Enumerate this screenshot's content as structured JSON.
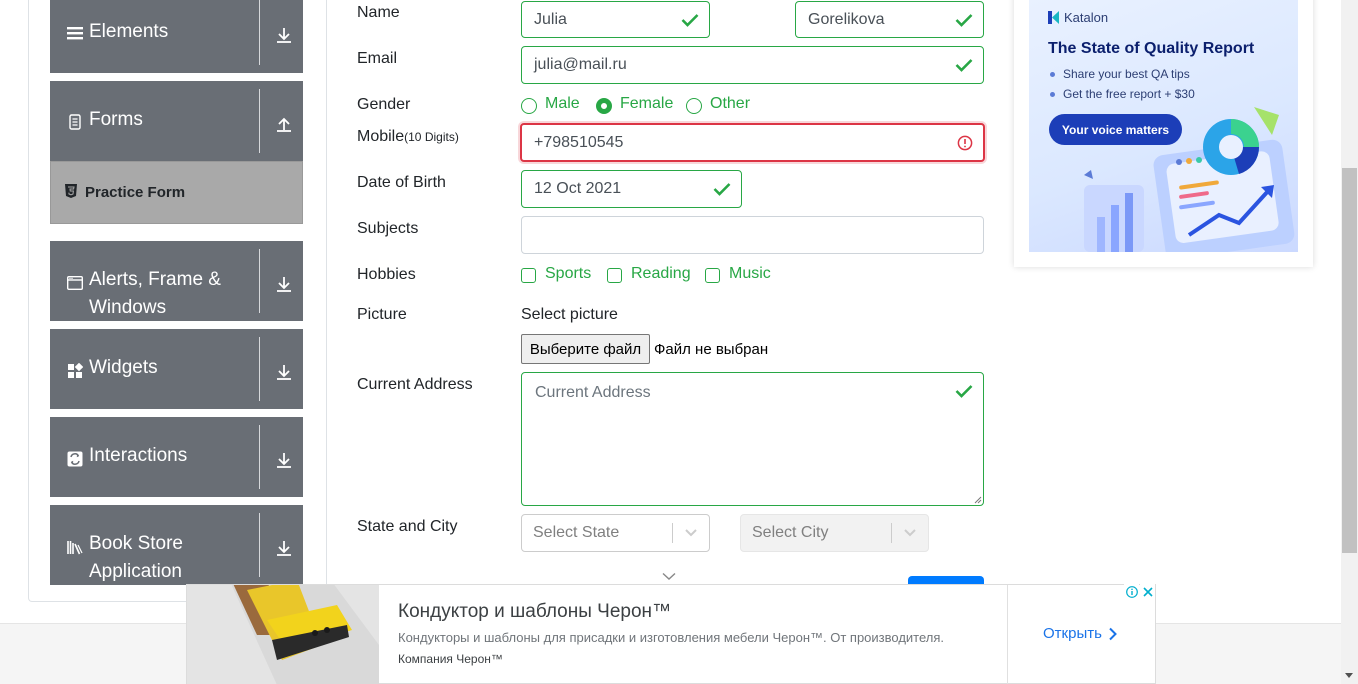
{
  "sidebar": {
    "groups": [
      {
        "label": "Elements",
        "icon": "list-icon",
        "arrow": "arrow-down-icon"
      },
      {
        "label": "Forms",
        "icon": "document-icon",
        "arrow": "arrow-up-icon"
      },
      {
        "label": "Alerts, Frame & Windows",
        "label_line1": "Alerts, Frame &",
        "label_line2": "Windows",
        "icon": "window-icon",
        "arrow": "arrow-down-icon"
      },
      {
        "label": "Widgets",
        "icon": "widgets-icon",
        "arrow": "arrow-down-icon"
      },
      {
        "label": "Interactions",
        "icon": "interactions-icon",
        "arrow": "arrow-down-icon"
      },
      {
        "label": "Book Store Application",
        "label_line1": "Book Store",
        "label_line2": "Application",
        "icon": "books-icon",
        "arrow": "arrow-down-icon"
      }
    ],
    "active_item": {
      "label": "Practice Form",
      "icon": "html5-icon"
    }
  },
  "form": {
    "name": {
      "label": "Name",
      "first_name": "Julia",
      "last_name": "Gorelikova"
    },
    "email": {
      "label": "Email",
      "value": "julia@mail.ru"
    },
    "gender": {
      "label": "Gender",
      "options": [
        "Male",
        "Female",
        "Other"
      ],
      "selected": "Female"
    },
    "mobile": {
      "label": "Mobile",
      "hint": "(10 Digits)",
      "value": "+798510545",
      "state": "invalid"
    },
    "dob": {
      "label": "Date of Birth",
      "value": "12 Oct 2021"
    },
    "subjects": {
      "label": "Subjects",
      "value": ""
    },
    "hobbies": {
      "label": "Hobbies",
      "options": [
        "Sports",
        "Reading",
        "Music"
      ]
    },
    "picture": {
      "label": "Picture",
      "caption": "Select picture",
      "button": "Выберите файл",
      "status": "Файл не выбран"
    },
    "address": {
      "label": "Current Address",
      "placeholder": "Current Address"
    },
    "state_city": {
      "label": "State and City",
      "state_placeholder": "Select State",
      "city_placeholder": "Select City"
    }
  },
  "side_ad": {
    "brand": "Katalon",
    "title": "The State of Quality Report",
    "bullets": [
      "Share your best QA tips",
      "Get the free report + $30"
    ],
    "cta": "Your voice matters"
  },
  "bottom_ad": {
    "title": "Кондуктор и шаблоны Черон™",
    "description": "Кондукторы и шаблоны для присадки и изготовления мебели Черон™. От производителя.",
    "source": "Компания Черон™",
    "action": "Открыть"
  },
  "colors": {
    "valid": "#28a745",
    "invalid": "#dc3545",
    "sidebar": "#696e75",
    "active_item": "#a9a9a9",
    "ad_link": "#1a73e8"
  }
}
